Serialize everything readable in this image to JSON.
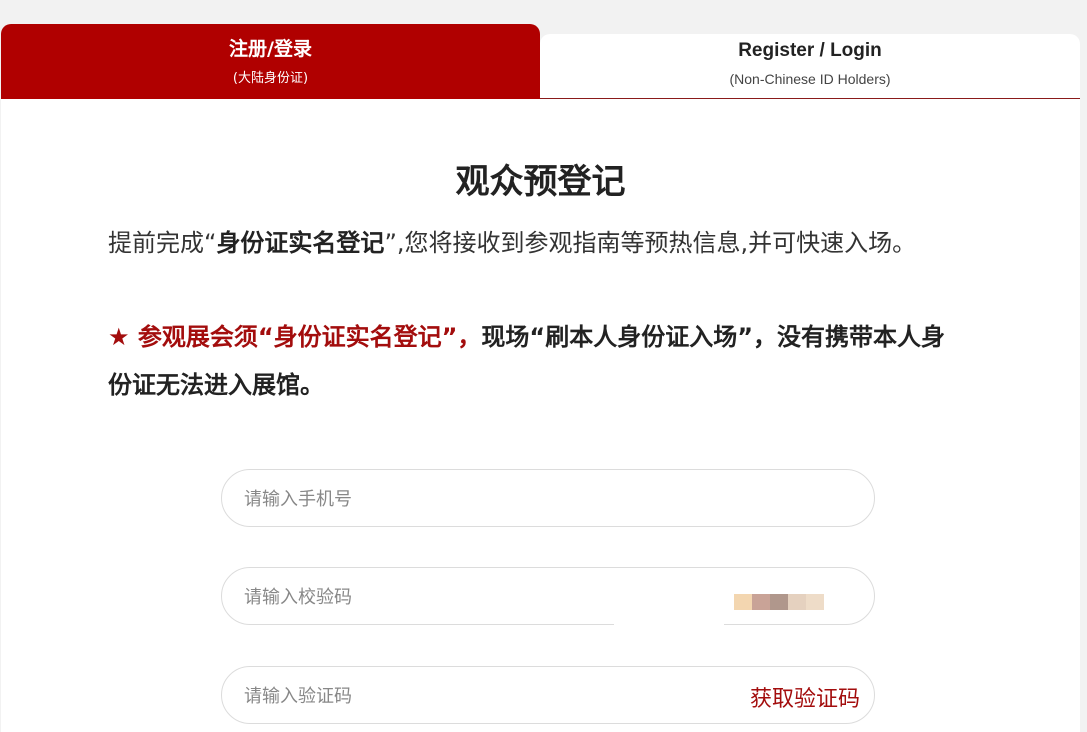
{
  "tabs": {
    "active": {
      "label": "注册/登录",
      "sub": "(大陆身份证)"
    },
    "inactive": {
      "label": "Register / Login",
      "sub": "(Non-Chinese ID Holders)"
    }
  },
  "main": {
    "title": "观众预登记",
    "intro_pre": "提前完成“",
    "intro_bold": "身份证实名登记",
    "intro_post": "”,您将接收到参观指南等预热信息,并可快速入场。",
    "notice_star": "★",
    "notice_red": " 参观展会须“身份证实名登记”，",
    "notice_black": "现场“刷本人身份证入场”，没有携带本人身份证无法进入展馆。"
  },
  "form": {
    "phone_placeholder": "请输入手机号",
    "captcha_placeholder": "请输入校验码",
    "sms_placeholder": "请输入验证码",
    "get_code_label": "获取验证码"
  },
  "colors": {
    "brand_red": "#b00000",
    "text_red": "#a30d0d"
  }
}
